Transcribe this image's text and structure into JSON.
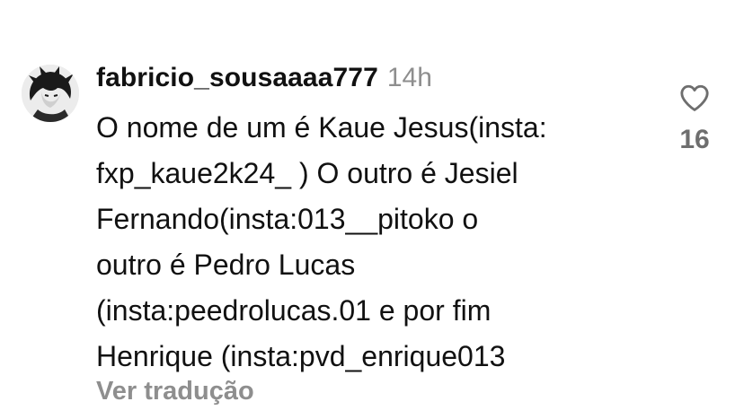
{
  "comment": {
    "avatar_icon": "user-avatar",
    "username": "fabricio_sousaaaa777",
    "time": "14h",
    "text_lines": [
      "O nome de um é Kaue Jesus(insta:",
      "fxp_kaue2k24_ ) O outro é Jesiel",
      "Fernando(insta:013__pitoko o",
      "outro é Pedro Lucas",
      "(insta:peedrolucas.01 e por fim",
      "Henrique (insta:pvd_enrique013"
    ],
    "translate_label": "Ver tradução",
    "like_icon": "heart-outline-icon",
    "like_count": "16"
  }
}
